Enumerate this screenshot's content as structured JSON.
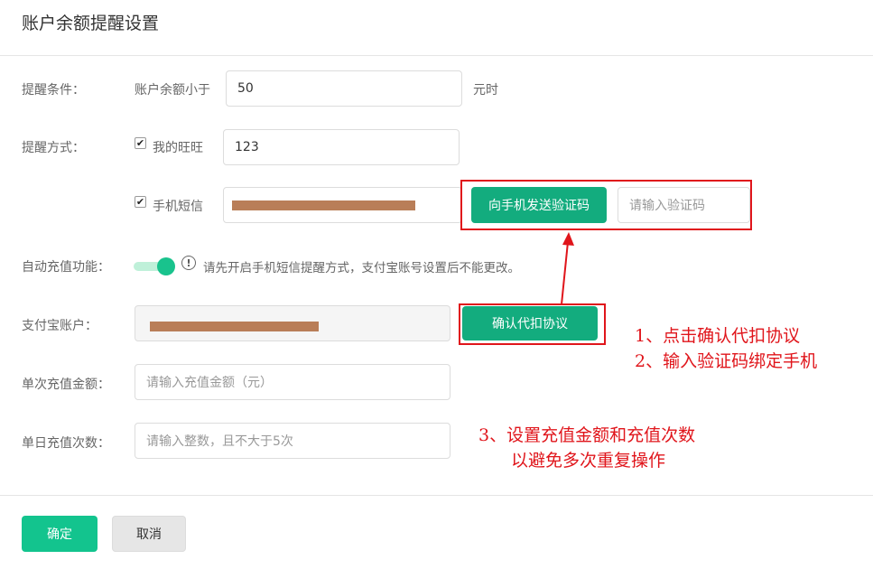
{
  "page": {
    "title": "账户余额提醒设置"
  },
  "form": {
    "alert_condition": {
      "label": "提醒条件：",
      "prefix": "账户余额小于",
      "value": "50",
      "suffix": "元时"
    },
    "alert_method": {
      "label": "提醒方式：",
      "wangwang_label": "我的旺旺",
      "wangwang_checked": true,
      "wangwang_value": "123",
      "sms_label": "手机短信",
      "sms_checked": true,
      "send_code_button": "向手机发送验证码",
      "code_placeholder": "请输入验证码"
    },
    "auto_recharge": {
      "label": "自动充值功能：",
      "enabled": true,
      "hint": "请先开启手机短信提醒方式，支付宝账号设置后不能更改。"
    },
    "alipay": {
      "label": "支付宝账户：",
      "confirm_agreement_button": "确认代扣协议"
    },
    "single_amount": {
      "label": "单次充值金额：",
      "placeholder": "请输入充值金额（元）"
    },
    "daily_count": {
      "label": "单日充值次数：",
      "placeholder": "请输入整数，且不大于5次"
    }
  },
  "annotations": {
    "step1": "1、点击确认代扣协议",
    "step2": "2、输入验证码绑定手机",
    "step3_line1": "3、设置充值金额和充值次数",
    "step3_line2": "以避免多次重复操作",
    "color": "#e0151b"
  },
  "footer": {
    "ok_button": "确定",
    "cancel_button": "取消"
  },
  "colors": {
    "primary": "#13ac7e",
    "confirm": "#13c48e",
    "redaction": "#b97e58"
  }
}
